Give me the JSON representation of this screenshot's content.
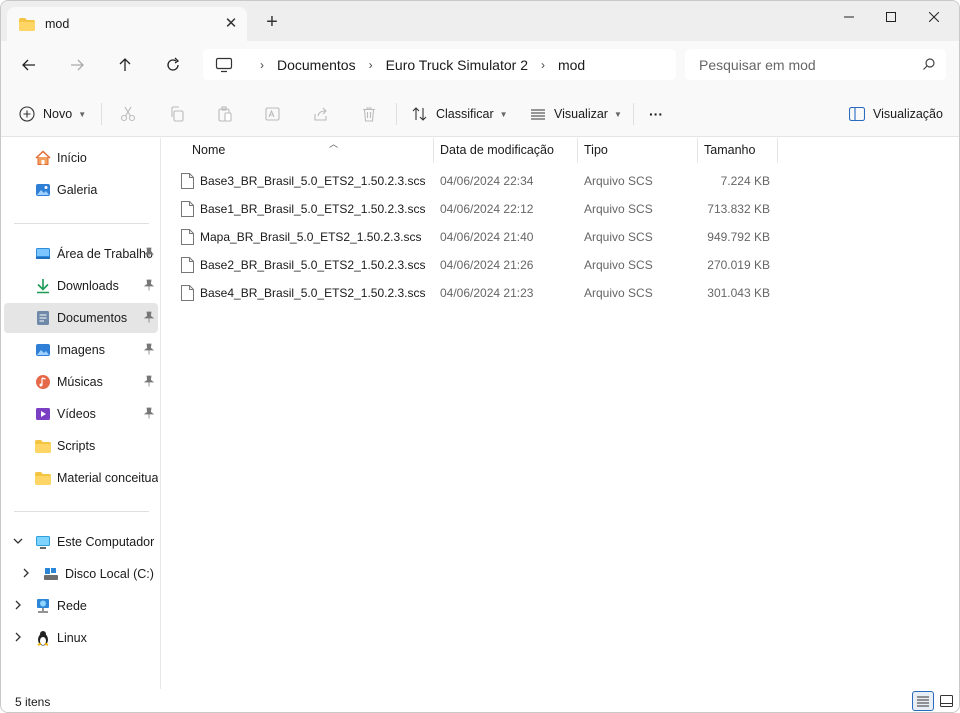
{
  "tab": {
    "title": "mod",
    "close_glyph": "✕",
    "new_tab_glyph": "+"
  },
  "window_controls": {
    "minimize": "minimize-icon",
    "maximize": "maximize-icon",
    "close": "close-icon"
  },
  "nav": {
    "back": "arrow-left-icon",
    "forward": "arrow-right-icon",
    "up": "arrow-up-icon",
    "refresh": "refresh-icon",
    "breadcrumbs": [
      "Documentos",
      "Euro Truck Simulator 2",
      "mod"
    ],
    "crumb_separator": "›",
    "search_placeholder": "Pesquisar em mod"
  },
  "commands": {
    "new_label": "Novo",
    "sort_label": "Classificar",
    "view_label": "Visualizar",
    "more_label": "···",
    "details_label": "Visualização"
  },
  "sidebar": {
    "items": [
      {
        "label": "Início",
        "icon": "home-icon"
      },
      {
        "label": "Galeria",
        "icon": "gallery-icon"
      },
      {
        "label": "Área de Trabalho",
        "icon": "desktop-icon",
        "pinned": true
      },
      {
        "label": "Downloads",
        "icon": "download-icon",
        "pinned": true
      },
      {
        "label": "Documentos",
        "icon": "documents-icon",
        "pinned": true,
        "selected": true
      },
      {
        "label": "Imagens",
        "icon": "pictures-icon",
        "pinned": true
      },
      {
        "label": "Músicas",
        "icon": "music-icon",
        "pinned": true
      },
      {
        "label": "Vídeos",
        "icon": "videos-icon",
        "pinned": true
      },
      {
        "label": "Scripts",
        "icon": "folder-icon"
      },
      {
        "label": "Material conceitual",
        "icon": "folder-icon"
      },
      {
        "label": "Este Computador",
        "icon": "computer-icon",
        "expanded": true
      },
      {
        "label": "Disco Local (C:)",
        "icon": "drive-icon"
      },
      {
        "label": "Rede",
        "icon": "network-icon"
      },
      {
        "label": "Linux",
        "icon": "linux-icon"
      }
    ]
  },
  "table": {
    "columns": [
      "Nome",
      "Data de modificação",
      "Tipo",
      "Tamanho"
    ],
    "rows": [
      {
        "name": "Base3_BR_Brasil_5.0_ETS2_1.50.2.3.scs",
        "date": "04/06/2024 22:34",
        "type": "Arquivo SCS",
        "size": "7.224 KB"
      },
      {
        "name": "Base1_BR_Brasil_5.0_ETS2_1.50.2.3.scs",
        "date": "04/06/2024 22:12",
        "type": "Arquivo SCS",
        "size": "713.832 KB"
      },
      {
        "name": "Mapa_BR_Brasil_5.0_ETS2_1.50.2.3.scs",
        "date": "04/06/2024 21:40",
        "type": "Arquivo SCS",
        "size": "949.792 KB"
      },
      {
        "name": "Base2_BR_Brasil_5.0_ETS2_1.50.2.3.scs",
        "date": "04/06/2024 21:26",
        "type": "Arquivo SCS",
        "size": "270.019 KB"
      },
      {
        "name": "Base4_BR_Brasil_5.0_ETS2_1.50.2.3.scs",
        "date": "04/06/2024 21:23",
        "type": "Arquivo SCS",
        "size": "301.043 KB"
      }
    ]
  },
  "status": {
    "count_text": "5 itens"
  },
  "colors": {
    "folder": "#f4c542",
    "accent": "#2a6bbd",
    "selected_bg": "#e5e5e5"
  }
}
